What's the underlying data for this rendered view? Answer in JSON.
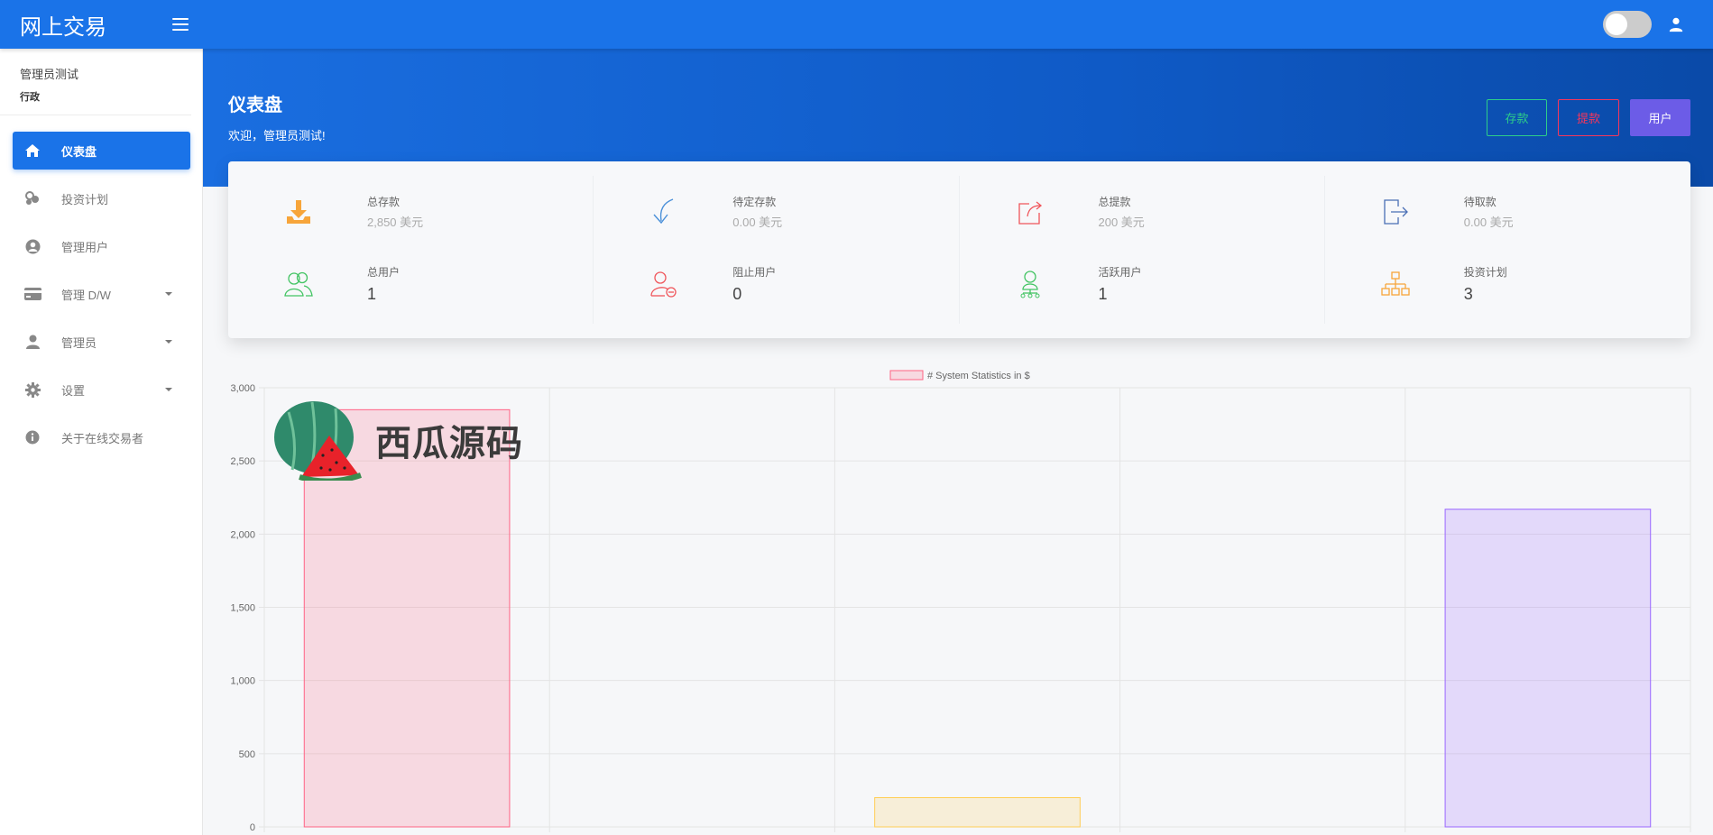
{
  "app": {
    "brand": "网上交易"
  },
  "sidebar": {
    "profile": {
      "name": "管理员测试",
      "role": "行政"
    },
    "items": [
      {
        "label": "仪表盘",
        "icon": "home-icon",
        "active": true
      },
      {
        "label": "投资计划",
        "icon": "coins-icon"
      },
      {
        "label": "管理用户",
        "icon": "user-circle-icon"
      },
      {
        "label": "管理 D/W",
        "icon": "credit-card-icon",
        "expandable": true
      },
      {
        "label": "管理员",
        "icon": "user-icon",
        "expandable": true
      },
      {
        "label": "设置",
        "icon": "gear-icon",
        "expandable": true
      },
      {
        "label": "关于在线交易者",
        "icon": "info-icon"
      }
    ]
  },
  "header": {
    "title": "仪表盘",
    "welcome": "欢迎，管理员测试!",
    "buttons": {
      "deposit": "存款",
      "withdraw": "提款",
      "users": "用户"
    }
  },
  "stats": [
    {
      "label": "总存款",
      "value": "2,850 美元",
      "icon": "download-icon",
      "color": "#f7a53a"
    },
    {
      "label": "总用户",
      "value": "1",
      "icon": "users-icon",
      "color": "#43c463"
    },
    {
      "label": "待定存款",
      "value": "0.00 美元",
      "icon": "arrow-curve-icon",
      "color": "#4a90d9"
    },
    {
      "label": "阻止用户",
      "value": "0",
      "icon": "user-blocked-icon",
      "color": "#f0565b"
    },
    {
      "label": "总提款",
      "value": "200 美元",
      "icon": "share-out-icon",
      "color": "#f0565b"
    },
    {
      "label": "活跃用户",
      "value": "1",
      "icon": "user-network-icon",
      "color": "#43c463"
    },
    {
      "label": "待取款",
      "value": "0.00 美元",
      "icon": "exit-icon",
      "color": "#4a6fb5"
    },
    {
      "label": "投资计划",
      "value": "3",
      "icon": "sitemap-icon",
      "color": "#f7a53a"
    }
  ],
  "watermark": {
    "text": "西瓜源码"
  },
  "chart_data": {
    "type": "bar",
    "legend": "# System Statistics in $",
    "legend_position": "top-center",
    "categories": [
      "",
      "",
      "",
      "",
      ""
    ],
    "values": [
      2850,
      0,
      200,
      0,
      2170
    ],
    "fill_colors": [
      "rgba(255,99,132,0.2)",
      "rgba(54,162,235,0.2)",
      "rgba(255,206,86,0.2)",
      "rgba(75,192,192,0.2)",
      "rgba(153,102,255,0.2)"
    ],
    "stroke_colors": [
      "rgba(255,99,132,1)",
      "rgba(54,162,235,1)",
      "rgba(255,206,86,1)",
      "rgba(75,192,192,1)",
      "rgba(153,102,255,1)"
    ],
    "yticks": [
      "0",
      "500",
      "1,000",
      "1,500",
      "2,000",
      "2,500",
      "3,000"
    ],
    "ylim": [
      0,
      3000
    ],
    "grid": true
  }
}
